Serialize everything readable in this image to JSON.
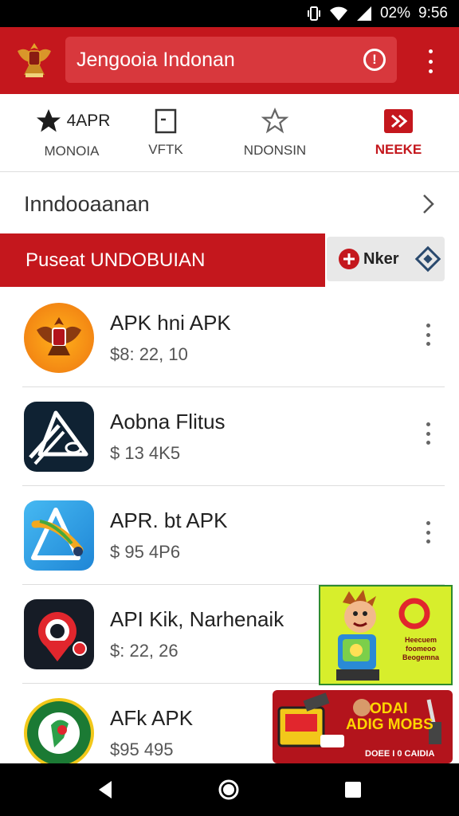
{
  "status_bar": {
    "battery": "02%",
    "time": "9:56",
    "icons": [
      "vibrate-icon",
      "wifi-icon",
      "signal-icon"
    ]
  },
  "app_bar": {
    "search_text": "Jengooia Indonan",
    "icons": [
      "emblem-logo",
      "info-icon",
      "more-vert-icon"
    ]
  },
  "tabs": [
    {
      "label": "MONOIA",
      "extra": "4APR",
      "icon": "star-filled-icon"
    },
    {
      "label": "VFTK",
      "icon": "bookmark-box-icon",
      "active": true
    },
    {
      "label": "NDONSIN",
      "icon": "star-outline-icon"
    },
    {
      "label": "NEEKE",
      "icon": "play-box-icon"
    }
  ],
  "nav_row": {
    "text": "Inndooaanan"
  },
  "banner": {
    "title": "Puseat UNDOBUIAN",
    "side_label": "Nker",
    "accent": "#c4171d"
  },
  "apps": [
    {
      "title": "APK hni APK",
      "price": "$8: 22, 10",
      "icon": "garuda-app-icon"
    },
    {
      "title": "Aobna Flitus",
      "price": "$ 13 4K5",
      "icon": "triangle-app-icon"
    },
    {
      "title": "APR. bt APK",
      "price": "$ 95 4P6",
      "icon": "compass-app-icon"
    },
    {
      "title": "API Kik, Narhenaik",
      "price": "$: 22, 26",
      "icon": "location-pin-app-icon"
    },
    {
      "title": "AFk APK",
      "price": "$95 495",
      "icon": "map-app-icon"
    }
  ],
  "ads": {
    "ad1_text": "Heecuem foomeoo Beogemna",
    "ad2_title_line1": "ODAI",
    "ad2_title_line2": "ADIG MOBS",
    "ad2_footer": "DOEE I 0 CAIDIA"
  },
  "nav_bar": {
    "icons": [
      "back-icon",
      "home-icon",
      "recents-icon"
    ]
  },
  "colors": {
    "primary": "#c4171d",
    "primary_light": "#d8383d",
    "ad_green": "#d7ee2c"
  }
}
